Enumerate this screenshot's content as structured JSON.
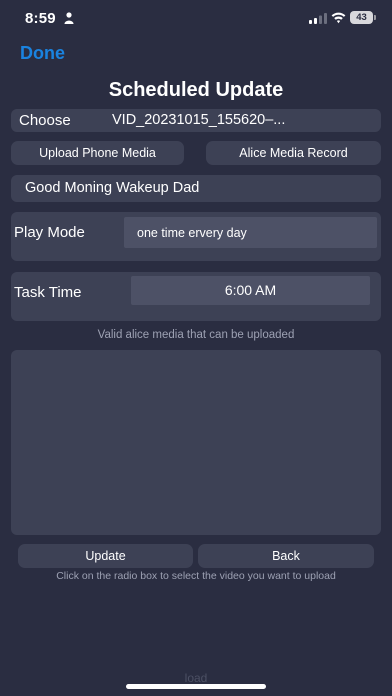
{
  "status_bar": {
    "time": "8:59",
    "battery_level": "43"
  },
  "nav": {
    "done_label": "Done"
  },
  "title": "Scheduled Update",
  "choose": {
    "label": "Choose",
    "value": "VID_20231015_155620–..."
  },
  "buttons": {
    "upload_phone_media": "Upload Phone Media",
    "alice_media_record": "Alice Media Record",
    "update": "Update",
    "back": "Back"
  },
  "task_name": "Good Moning Wakeup Dad",
  "play_mode": {
    "label": "Play Mode",
    "value": "one time ervery day"
  },
  "task_time": {
    "label": "Task Time",
    "value": "6:00 AM"
  },
  "valid_media_text": "Valid alice media that can be uploaded",
  "media_items": [],
  "hint_text": "Click on the radio box to select the video you want to upload",
  "load_text": "load",
  "icons": {
    "person": "person-icon",
    "signal": "cellular-signal-icon",
    "wifi": "wifi-icon",
    "battery": "battery-icon"
  },
  "colors": {
    "background": "#2a2d41",
    "panel": "#3d4155",
    "field": "#4d5166",
    "accent": "#1a83e0",
    "muted_text": "#9da1b3"
  }
}
